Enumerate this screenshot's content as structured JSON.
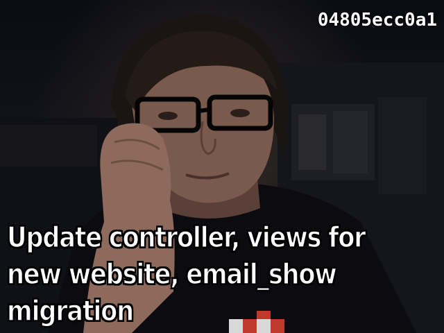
{
  "overlay": {
    "commit_hash": "04805ecc0a1",
    "commit_message": "Update controller, views for new website, email_show migration"
  },
  "colors": {
    "caption_text": "#ffffff",
    "caption_outline": "#000000",
    "background": "#0b0d12"
  }
}
